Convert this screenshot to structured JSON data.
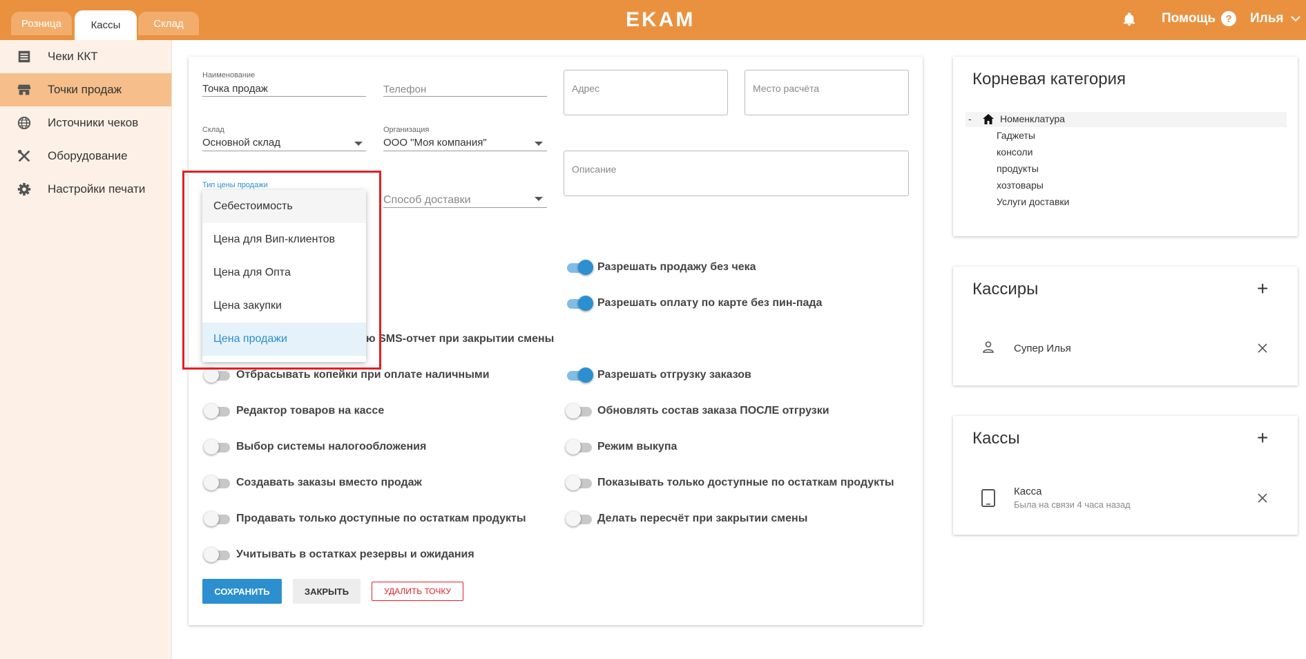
{
  "header": {
    "tabs": [
      {
        "label": "Розница"
      },
      {
        "label": "Кассы"
      },
      {
        "label": "Склад"
      }
    ],
    "logo": "EKAM",
    "help_label": "Помощь",
    "help_icon": "?",
    "user_label": "Илья",
    "chevron": "⌄"
  },
  "sidebar": {
    "items": [
      {
        "label": "Чеки ККТ",
        "icon": "receipt-list-icon"
      },
      {
        "label": "Точки продаж",
        "icon": "store-icon"
      },
      {
        "label": "Источники чеков",
        "icon": "globe-icon"
      },
      {
        "label": "Оборудование",
        "icon": "tools-icon"
      },
      {
        "label": "Настройки печати",
        "icon": "gear-icon"
      }
    ]
  },
  "form": {
    "name": {
      "label": "Наименование",
      "value": "Точка продаж"
    },
    "phone": {
      "placeholder": "Телефон"
    },
    "address": {
      "placeholder": "Адрес"
    },
    "payment_place": {
      "placeholder": "Место расчёта"
    },
    "warehouse": {
      "label": "Склад",
      "value": "Основной склад"
    },
    "organization": {
      "label": "Организация",
      "value": "ООО \"Моя компания\""
    },
    "description": {
      "placeholder": "Описание"
    },
    "price_type": {
      "label": "Тип цены продажи"
    },
    "delivery": {
      "placeholder": "Способ доставки"
    },
    "sms_partial": "ю SMS-отчет при закрытии смены",
    "toggles_left": [
      {
        "label": "Отбрасывать копейки при оплате наличными",
        "on": false
      },
      {
        "label": "Редактор товаров на кассе",
        "on": false
      },
      {
        "label": "Выбор системы налогообложения",
        "on": false
      },
      {
        "label": "Создавать заказы вместо продаж",
        "on": false
      },
      {
        "label": "Продавать только доступные по остаткам продукты",
        "on": false
      },
      {
        "label": "Учитывать в остатках резервы и ожидания",
        "on": false
      }
    ],
    "toggles_right": [
      {
        "label": "Разрешать продажу без чека",
        "on": true
      },
      {
        "label": "Разрешать оплату по карте без пин-пада",
        "on": true
      },
      {
        "label": "Разрешать отгрузку заказов",
        "on": true
      },
      {
        "label": "Обновлять состав заказа ПОСЛЕ отгрузки",
        "on": false
      },
      {
        "label": "Режим выкупа",
        "on": false
      },
      {
        "label": "Показывать только доступные по остаткам продукты",
        "on": false
      },
      {
        "label": "Делать пересчёт при закрытии смены",
        "on": false
      }
    ],
    "buttons": {
      "save": "СОХРАНИТЬ",
      "close": "ЗАКРЫТЬ",
      "delete": "УДАЛИТЬ ТОЧКУ"
    }
  },
  "dropdown": {
    "options": [
      {
        "label": "Себестоимость"
      },
      {
        "label": "Цена для Вип-клиентов"
      },
      {
        "label": "Цена для Опта"
      },
      {
        "label": "Цена закупки"
      },
      {
        "label": "Цена продажи",
        "selected": true
      }
    ]
  },
  "category_panel": {
    "title": "Корневая категория",
    "collapse": "-",
    "root": "Номенклатура",
    "children": [
      "Гаджеты",
      "консоли",
      "продукты",
      "хозтовары",
      "Услуги доставки"
    ]
  },
  "cashiers_panel": {
    "title": "Кассиры",
    "add": "+",
    "items": [
      {
        "name": "Супер Илья"
      }
    ]
  },
  "registers_panel": {
    "title": "Кассы",
    "add": "+",
    "items": [
      {
        "name": "Касса",
        "status": "Была на связи 4 часа назад"
      }
    ]
  },
  "colors": {
    "header": "#ea913f",
    "accent": "#2b8fd0",
    "highlight": "#e31e24",
    "sidebar_active": "#f5be8a"
  }
}
